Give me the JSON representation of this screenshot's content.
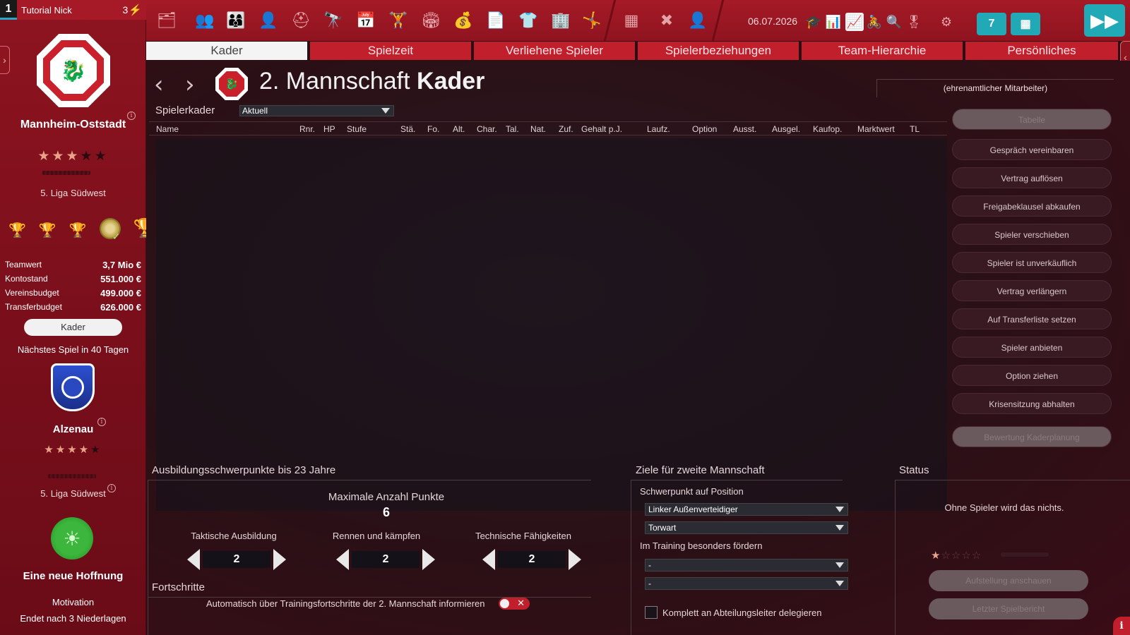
{
  "profile": {
    "slot": "1",
    "name": "Tutorial Nick",
    "energy": "3"
  },
  "club": {
    "name": "Mannheim-Oststadt",
    "stars_filled": 3,
    "stars_total": 5,
    "league": "5. Liga Südwest",
    "finance": [
      {
        "label": "Teamwert",
        "value": "3,7 Mio €"
      },
      {
        "label": "Kontostand",
        "value": "551.000 €"
      },
      {
        "label": "Vereinsbudget",
        "value": "499.000 €"
      },
      {
        "label": "Transferbudget",
        "value": "626.000 €"
      }
    ],
    "squad_button": "Kader"
  },
  "next_match": {
    "text": "Nächstes Spiel in 40 Tagen",
    "opponent": "Alzenau",
    "stars_filled": 4,
    "stars_total": 5,
    "league": "5. Liga Südwest"
  },
  "mood": {
    "title": "Eine neue Hoffnung",
    "label": "Motivation",
    "subtext": "Endet nach 3 Niederlagen"
  },
  "toolbar": {
    "date": "06.07.2026",
    "calendar_day_label": "7",
    "accent_color": "#22a9b6"
  },
  "tabs": [
    {
      "label": "Kader",
      "active": true
    },
    {
      "label": "Spielzeit",
      "active": false
    },
    {
      "label": "Verliehene Spieler",
      "active": false
    },
    {
      "label": "Spielerbeziehungen",
      "active": false
    },
    {
      "label": "Team-Hierarchie",
      "active": false
    },
    {
      "label": "Persönliches",
      "active": false
    }
  ],
  "page": {
    "title_prefix": "2. Mannschaft",
    "title_main": "Kader",
    "staff_role": "(ehrenamtlicher Mitarbeiter)"
  },
  "squad": {
    "label": "Spielerkader",
    "filter_value": "Aktuell",
    "columns": [
      "Name",
      "Rnr.",
      "HP",
      "Stufe",
      "Stä.",
      "Fo.",
      "Alt.",
      "Char.",
      "Tal.",
      "Nat.",
      "Zuf.",
      "Gehalt p.J.",
      "Laufz.",
      "Option",
      "Ausst.",
      "Ausgel.",
      "Kaufop.",
      "Marktwert",
      "TL"
    ],
    "rows": []
  },
  "actions": [
    {
      "label": "Tabelle",
      "disabled": true
    },
    {
      "label": "Gespräch vereinbaren",
      "disabled": false
    },
    {
      "label": "Vertrag auflösen",
      "disabled": false
    },
    {
      "label": "Freigabeklausel abkaufen",
      "disabled": false
    },
    {
      "label": "Spieler verschieben",
      "disabled": false
    },
    {
      "label": "Spieler ist unverkäuflich",
      "disabled": false
    },
    {
      "label": "Vertrag verlängern",
      "disabled": false
    },
    {
      "label": "Auf Transferliste setzen",
      "disabled": false
    },
    {
      "label": "Spieler anbieten",
      "disabled": false
    },
    {
      "label": "Option ziehen",
      "disabled": false
    },
    {
      "label": "Krisensitzung abhalten",
      "disabled": false
    },
    {
      "label": "Bewertung Kaderplanung",
      "disabled": true
    }
  ],
  "training": {
    "title": "Ausbildungsschwerpunkte bis 23 Jahre",
    "max_points_label": "Maximale Anzahl Punkte",
    "max_points": "6",
    "items": [
      {
        "label": "Taktische Ausbildung",
        "value": "2"
      },
      {
        "label": "Rennen und kämpfen",
        "value": "2"
      },
      {
        "label": "Technische Fähigkeiten",
        "value": "2"
      }
    ],
    "progress_title": "Fortschritte",
    "progress_toggle_label": "Automatisch über Trainingsfortschritte der 2. Mannschaft informieren",
    "progress_toggle_on": false
  },
  "goals": {
    "title": "Ziele für zweite Mannschaft",
    "position_label": "Schwerpunkt auf Position",
    "position_1": "Linker Außenverteidiger",
    "position_2": "Torwart",
    "training_label": "Im Training besonders fördern",
    "training_1": "-",
    "training_2": "-",
    "delegate_label": "Komplett an Abteilungsleiter delegieren",
    "delegate_checked": false
  },
  "status": {
    "title": "Status",
    "text": "Ohne Spieler wird das nichts.",
    "stars_filled": 1,
    "stars_total": 5,
    "buttons": [
      "Aufstellung anschauen",
      "Letzter Spielbericht"
    ]
  }
}
